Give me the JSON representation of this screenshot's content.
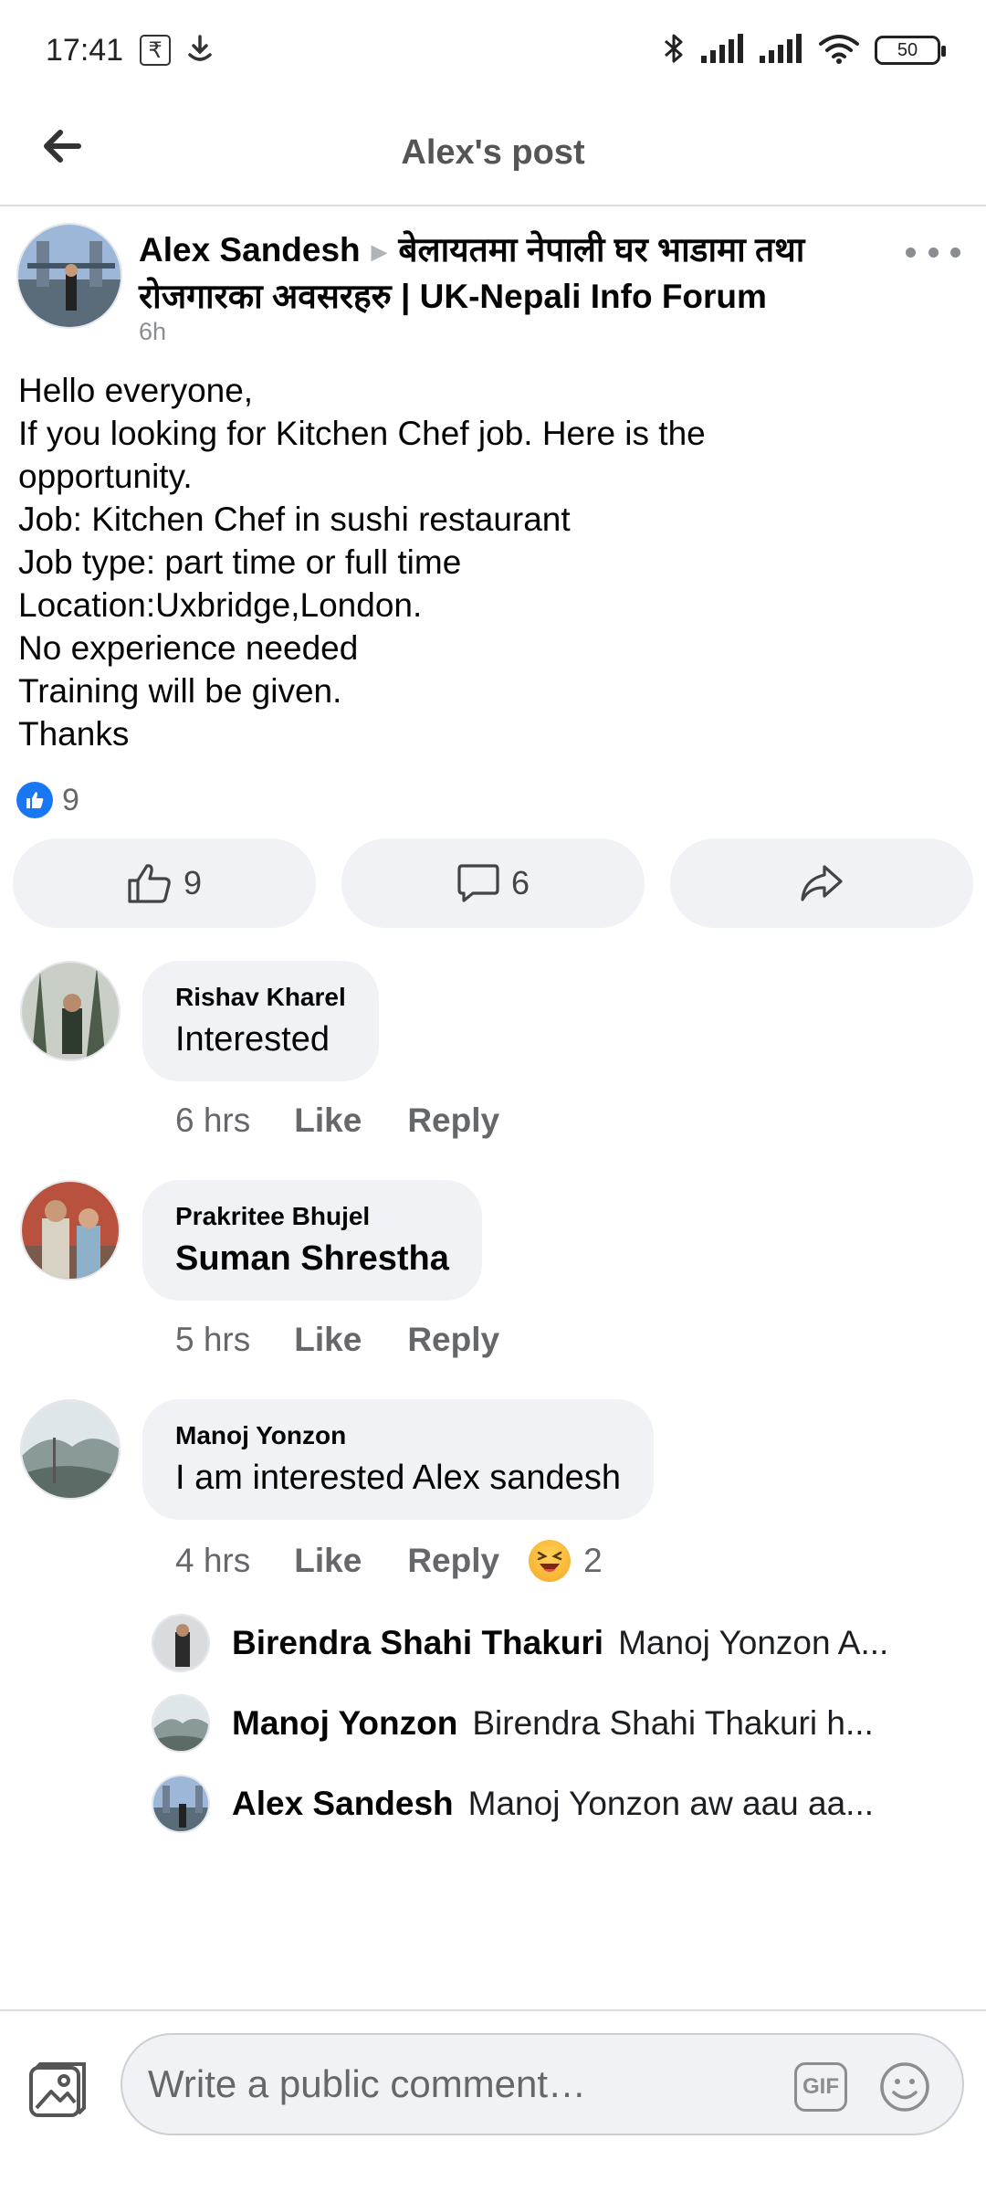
{
  "status_bar": {
    "time": "17:41",
    "rupee_symbol": "₹",
    "battery": "50"
  },
  "header": {
    "title": "Alex's post"
  },
  "post": {
    "author": "Alex Sandesh",
    "group": "बेलायतमा नेपाली घर भाडामा तथा रोजगारका अवसरहरु | UK-Nepali Info Forum",
    "time": "6h",
    "lines": [
      "Hello everyone,",
      "If you looking for Kitchen Chef job. Here is the",
      "opportunity.",
      "Job: Kitchen Chef in sushi restaurant",
      "Job type: part time or full time",
      "Location:Uxbridge,London.",
      "No experience needed",
      "Training will be given.",
      "Thanks"
    ],
    "reaction_count": "9"
  },
  "actions": {
    "like_count": "9",
    "comment_count": "6"
  },
  "comments": [
    {
      "name": "Rishav Kharel",
      "text": "Interested",
      "time": "6 hrs",
      "like": "Like",
      "reply": "Reply"
    },
    {
      "name": "Prakritee Bhujel",
      "text": "Suman Shrestha",
      "time": "5 hrs",
      "like": "Like",
      "reply": "Reply"
    },
    {
      "name": "Manoj Yonzon",
      "text": "I am interested  Alex sandesh",
      "time": "4 hrs",
      "like": "Like",
      "reply": "Reply",
      "reaction_count": "2"
    }
  ],
  "replies": [
    {
      "name": "Birendra Shahi Thakuri",
      "text": "Manoj Yonzon A..."
    },
    {
      "name": "Manoj Yonzon",
      "text": "Birendra Shahi Thakuri  h..."
    },
    {
      "name": "Alex Sandesh",
      "text": "Manoj Yonzon aw aau aa..."
    }
  ],
  "composer": {
    "placeholder": "Write a public comment…",
    "gif_label": "GIF"
  },
  "colors": {
    "accent": "#1877f2",
    "bubble": "#f0f2f5",
    "muted": "#65676b"
  }
}
